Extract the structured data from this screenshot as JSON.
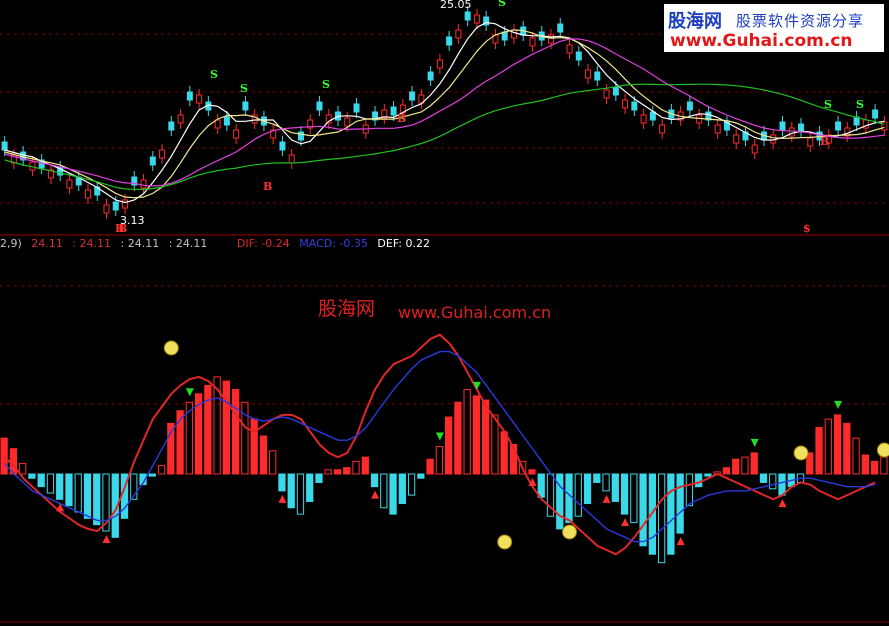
{
  "watermark": {
    "cn": "股海网",
    "url": "www.Guhai.com.cn"
  },
  "logo": {
    "brand": "股海网",
    "tagline": "股票软件资源分享",
    "url": "www.Guhai.com.cn"
  },
  "hud": {
    "param": "2,9)",
    "v1": "24.11",
    "v2": ": 24.11",
    "v3": ": 24.11",
    "v4": ": 24.11",
    "dif": "DIF: -0.24",
    "macd": "MACD: -0.35",
    "def": "DEF: 0.22"
  },
  "price_labels": {
    "high": "25.05",
    "low": "3.13"
  },
  "colors": {
    "up": "#ff2a2a",
    "down": "#3ad8e8",
    "dif": "#e02828",
    "dea": "#2a3adb",
    "ma5": "#ffffff",
    "ma10": "#f0e68c",
    "ma20": "#e040e0",
    "ma60": "#20c020",
    "grid": "#7a0000"
  },
  "chart_data": [
    {
      "type": "candlestick",
      "title": "",
      "annotations": [
        "25.05",
        "3.13"
      ],
      "signals": [
        {
          "label": "S",
          "bar": 25
        },
        {
          "label": "S",
          "bar": 28
        },
        {
          "label": "S",
          "bar": 36
        },
        {
          "label": "S",
          "bar": 45
        },
        {
          "label": "S",
          "bar": 63
        },
        {
          "label": "S",
          "bar": 93
        },
        {
          "label": "S",
          "bar": 97
        },
        {
          "label": "B",
          "bar": 12
        },
        {
          "label": "B",
          "bar": 31
        },
        {
          "label": "B",
          "bar": 46
        },
        {
          "label": "B",
          "bar": 94
        },
        {
          "label": "B",
          "bar": 13
        },
        {
          "label": "$",
          "bar": 92
        }
      ],
      "ylim": [
        3.0,
        26.0
      ]
    },
    {
      "type": "bar",
      "title": "",
      "series": [
        {
          "name": "MACD",
          "values": [
            0.17,
            0.12,
            0.05,
            -0.02,
            -0.06,
            -0.09,
            -0.12,
            -0.15,
            -0.18,
            -0.21,
            -0.24,
            -0.27,
            -0.3,
            -0.21,
            -0.12,
            -0.05,
            -0.01,
            0.04,
            0.24,
            0.3,
            0.34,
            0.38,
            0.42,
            0.46,
            0.44,
            0.4,
            0.34,
            0.26,
            0.18,
            0.11,
            -0.08,
            -0.16,
            -0.19,
            -0.13,
            -0.04,
            0.02,
            0.02,
            0.03,
            0.06,
            0.08,
            -0.06,
            -0.16,
            -0.19,
            -0.14,
            -0.1,
            -0.02,
            0.07,
            0.13,
            0.27,
            0.34,
            0.4,
            0.37,
            0.35,
            0.28,
            0.2,
            0.14,
            0.06,
            0.02,
            -0.11,
            -0.2,
            -0.26,
            -0.23,
            -0.2,
            -0.14,
            -0.04,
            -0.08,
            -0.13,
            -0.19,
            -0.23,
            -0.34,
            -0.38,
            -0.42,
            -0.38,
            -0.28,
            -0.15,
            -0.06,
            -0.01,
            0.01,
            0.03,
            0.07,
            0.08,
            0.1,
            -0.04,
            -0.07,
            -0.1,
            -0.06,
            -0.04,
            0.1,
            0.22,
            0.26,
            0.28,
            0.24,
            0.17,
            0.09,
            0.06,
            0.08
          ]
        }
      ],
      "lines": [
        {
          "name": "DIF",
          "values": [
            0.08,
            0.04,
            -0.02,
            -0.06,
            -0.1,
            -0.14,
            -0.18,
            -0.21,
            -0.24,
            -0.26,
            -0.27,
            -0.23,
            -0.17,
            -0.06,
            0.06,
            0.16,
            0.26,
            0.32,
            0.38,
            0.42,
            0.45,
            0.46,
            0.44,
            0.4,
            0.34,
            0.28,
            0.22,
            0.2,
            0.23,
            0.26,
            0.28,
            0.28,
            0.26,
            0.2,
            0.14,
            0.1,
            0.08,
            0.1,
            0.18,
            0.3,
            0.4,
            0.47,
            0.52,
            0.54,
            0.56,
            0.6,
            0.64,
            0.66,
            0.62,
            0.56,
            0.48,
            0.4,
            0.32,
            0.26,
            0.2,
            0.12,
            0.02,
            -0.06,
            -0.12,
            -0.16,
            -0.2,
            -0.22,
            -0.26,
            -0.3,
            -0.34,
            -0.36,
            -0.38,
            -0.35,
            -0.3,
            -0.24,
            -0.18,
            -0.12,
            -0.08,
            -0.06,
            -0.05,
            -0.04,
            -0.02,
            0.0,
            -0.02,
            -0.04,
            -0.06,
            -0.08,
            -0.1,
            -0.12,
            -0.1,
            -0.06,
            -0.04,
            -0.05,
            -0.08,
            -0.1,
            -0.12,
            -0.1,
            -0.08,
            -0.06,
            -0.04
          ]
        },
        {
          "name": "DEF",
          "values": [
            0.05,
            0.0,
            -0.04,
            -0.08,
            -0.1,
            -0.12,
            -0.14,
            -0.16,
            -0.18,
            -0.2,
            -0.22,
            -0.22,
            -0.2,
            -0.16,
            -0.1,
            -0.04,
            0.04,
            0.12,
            0.2,
            0.26,
            0.3,
            0.33,
            0.35,
            0.36,
            0.34,
            0.31,
            0.28,
            0.26,
            0.25,
            0.26,
            0.27,
            0.26,
            0.24,
            0.22,
            0.2,
            0.18,
            0.16,
            0.16,
            0.18,
            0.22,
            0.28,
            0.34,
            0.4,
            0.45,
            0.5,
            0.54,
            0.56,
            0.58,
            0.58,
            0.56,
            0.52,
            0.48,
            0.42,
            0.36,
            0.3,
            0.24,
            0.18,
            0.12,
            0.06,
            0.0,
            -0.06,
            -0.1,
            -0.14,
            -0.18,
            -0.22,
            -0.26,
            -0.28,
            -0.3,
            -0.32,
            -0.32,
            -0.3,
            -0.26,
            -0.22,
            -0.18,
            -0.14,
            -0.12,
            -0.1,
            -0.09,
            -0.08,
            -0.08,
            -0.08,
            -0.07,
            -0.06,
            -0.05,
            -0.04,
            -0.03,
            -0.02,
            -0.02,
            -0.03,
            -0.04,
            -0.05,
            -0.06,
            -0.06,
            -0.06,
            -0.05
          ]
        }
      ],
      "ylim": [
        -0.9,
        0.9
      ]
    }
  ]
}
